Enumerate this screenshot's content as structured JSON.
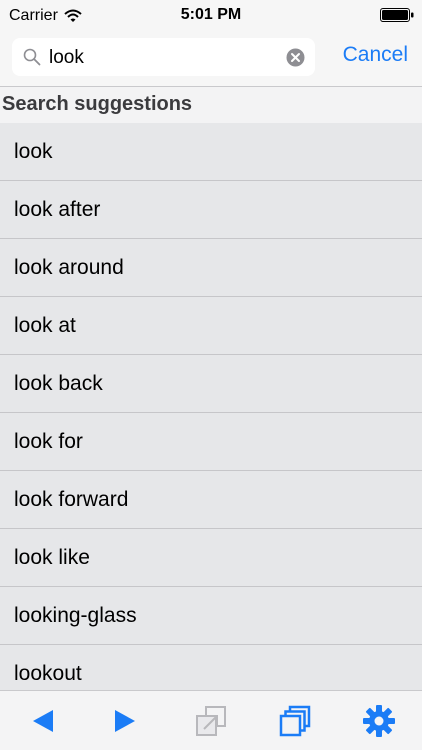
{
  "status_bar": {
    "carrier": "Carrier",
    "time": "5:01 PM"
  },
  "search": {
    "query": "look",
    "cancel_label": "Cancel"
  },
  "section": {
    "title": "Search suggestions"
  },
  "suggestions": [
    "look",
    "look after",
    "look around",
    "look at",
    "look back",
    "look for",
    "look forward",
    "look like",
    "looking-glass",
    "lookout"
  ],
  "toolbar": {
    "items": [
      {
        "icon": "back-arrow-icon",
        "enabled": true
      },
      {
        "icon": "forward-arrow-icon",
        "enabled": true
      },
      {
        "icon": "collapse-icon",
        "enabled": false
      },
      {
        "icon": "pages-icon",
        "enabled": true
      },
      {
        "icon": "gear-icon",
        "enabled": true
      }
    ]
  },
  "colors": {
    "accent": "#1b7cf6",
    "disabled": "#b8b8bc",
    "list_background": "#e6e7e9",
    "bar_background": "#f6f6f6"
  }
}
